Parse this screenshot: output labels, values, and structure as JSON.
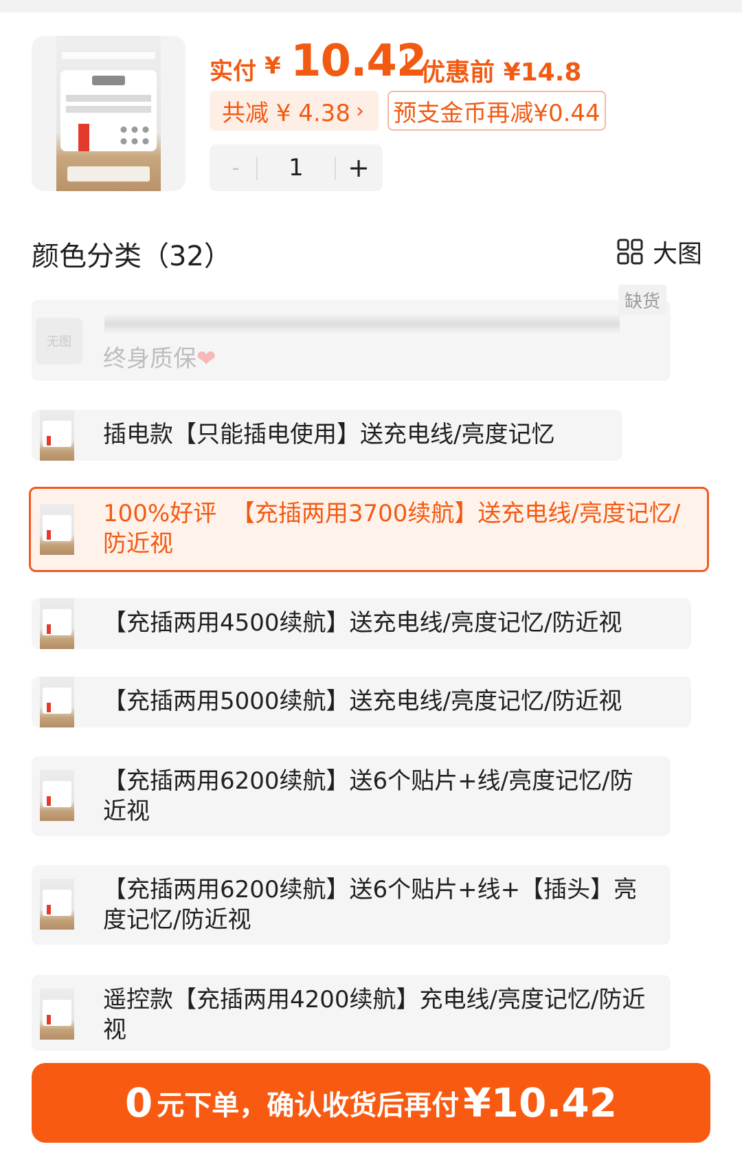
{
  "header": {
    "paid_label": "实付",
    "currency": "¥",
    "paid_amount": "10.42",
    "pre_discount_label": "优惠前",
    "pre_discount_amount": "¥14.8",
    "total_reduce": "共减 ¥ 4.38",
    "coin_reduce": "预支金币再减¥0.44",
    "quantity_minus": "-",
    "quantity": "1",
    "quantity_plus": "+"
  },
  "section": {
    "title": "颜色分类（32）",
    "big_view_label": "大图"
  },
  "out_of_stock": {
    "no_image_label": "无图",
    "badge": "缺货",
    "text": "终身质保",
    "heart": "❤"
  },
  "options": [
    {
      "label": "插电款【只能插电使用】送充电线/亮度记忆"
    },
    {
      "label": "100%好评  【充插两用3700续航】送充电线/亮度记忆/防近视"
    },
    {
      "label": "【充插两用4500续航】送充电线/亮度记忆/防近视"
    },
    {
      "label": "【充插两用5000续航】送充电线/亮度记忆/防近视"
    },
    {
      "label": "【充插两用6200续航】送6个贴片+线/亮度记忆/防近视"
    },
    {
      "label": "【充插两用6200续航】送6个贴片+线+【插头】亮度记忆/防近视"
    },
    {
      "label": "遥控款【充插两用4200续航】充电线/亮度记忆/防近视"
    }
  ],
  "cta": {
    "zero": "0",
    "text": "元下单，确认收货后再付",
    "amount": "¥10.42"
  },
  "colors": {
    "accent": "#f25a12",
    "cta_bg": "#f85a12",
    "selected_bg": "#fff2eb"
  }
}
